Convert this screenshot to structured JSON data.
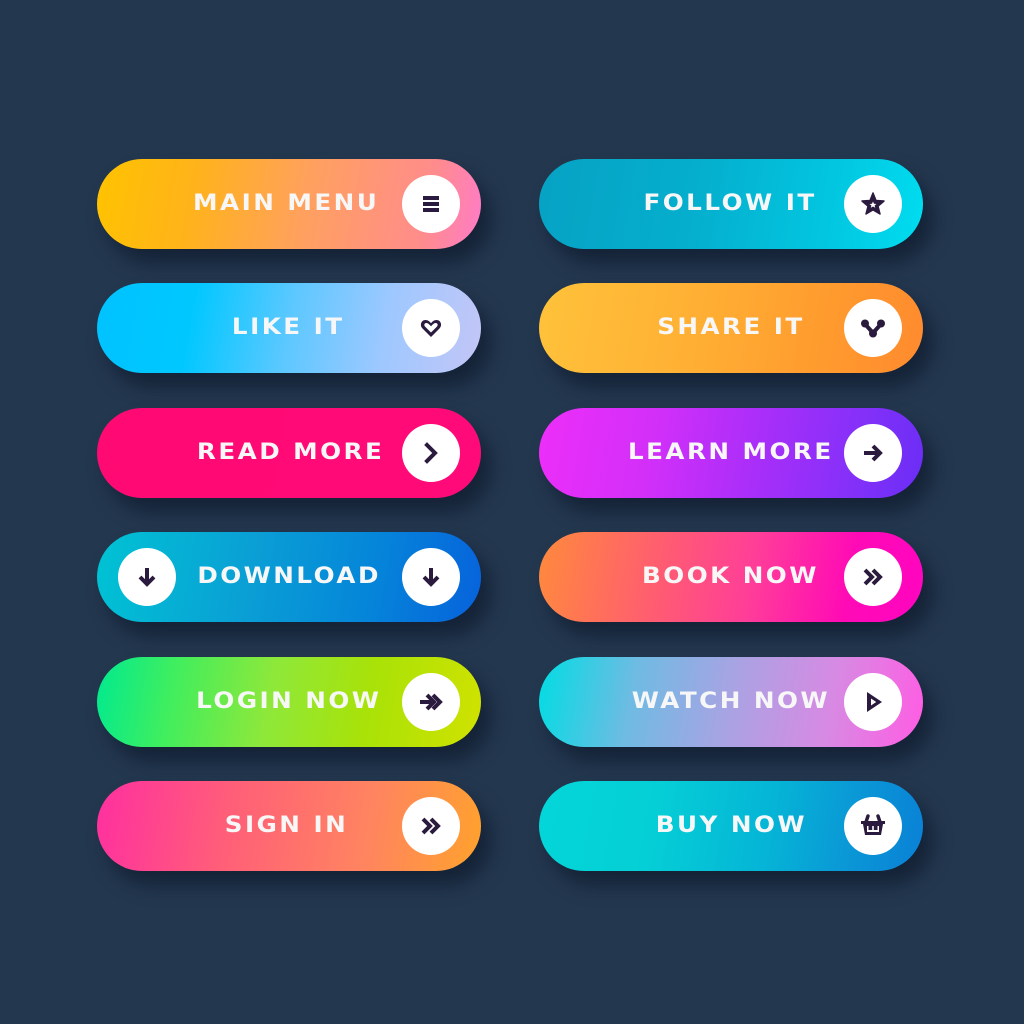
{
  "page": {
    "background_color": "#23374f",
    "icon_color": "#2a1a3e",
    "label_color": "#f7f7f7"
  },
  "buttons": [
    {
      "id": "main-menu",
      "label": "MAIN MENU",
      "icon": "hamburger-menu-icon",
      "gradient": [
        "#ffc300",
        "#ff7bc8"
      ]
    },
    {
      "id": "like-it",
      "label": "LIKE IT",
      "icon": "heart-icon",
      "gradient": [
        "#00c2ff",
        "#c4c6f6"
      ]
    },
    {
      "id": "read-more",
      "label": "READ MORE",
      "icon": "chevron-right-icon",
      "gradient": [
        "#ff0a73",
        "#ff0a78"
      ]
    },
    {
      "id": "download",
      "label": "DOWNLOAD",
      "icon": "arrow-down-icon",
      "icon_left": "arrow-down-icon",
      "gradient": [
        "#00c3d4",
        "#0762dc"
      ]
    },
    {
      "id": "login-now",
      "label": "LOGIN NOW",
      "icon": "arrow-right-double-icon",
      "gradient": [
        "#00ea90",
        "#d1e200"
      ]
    },
    {
      "id": "sign-in",
      "label": "SIGN IN",
      "icon": "double-chevron-right-icon",
      "gradient": [
        "#ff2fa0",
        "#ffa22c"
      ]
    },
    {
      "id": "follow-it",
      "label": "FOLLOW IT",
      "icon": "star-icon",
      "gradient": [
        "#06a2c4",
        "#00ddf0"
      ]
    },
    {
      "id": "share-it",
      "label": "SHARE IT",
      "icon": "share-nodes-icon",
      "gradient": [
        "#ffc23a",
        "#ff8a2e"
      ]
    },
    {
      "id": "learn-more",
      "label": "LEARN MORE",
      "icon": "arrow-right-icon",
      "gradient": [
        "#ee2ef9",
        "#6a2ef5"
      ]
    },
    {
      "id": "book-now",
      "label": "BOOK NOW",
      "icon": "double-chevron-right-icon",
      "gradient": [
        "#ff8a3c",
        "#ff05c0"
      ]
    },
    {
      "id": "watch-now",
      "label": "WATCH NOW",
      "icon": "play-icon",
      "gradient": [
        "#00dde3",
        "#ff5ce3"
      ]
    },
    {
      "id": "buy-now",
      "label": "BUY NOW",
      "icon": "shopping-basket-icon",
      "gradient": [
        "#03d6d8",
        "#0a80d6"
      ]
    }
  ]
}
